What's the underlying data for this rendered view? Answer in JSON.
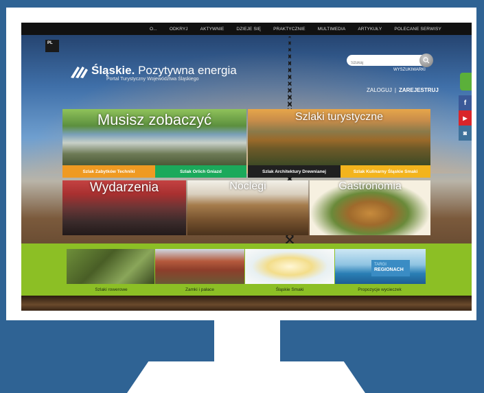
{
  "nav": {
    "items": [
      "O...",
      "ODKRYJ",
      "AKTYWNIE",
      "DZIEJE SIĘ",
      "PRAKTYCZNIE",
      "MULTIMEDIA",
      "ARTYKUŁY",
      "POLECANE SERWISY"
    ]
  },
  "lang": "PL",
  "logo": {
    "brand": "Śląskie.",
    "tagline": "Pozytywna energia",
    "sub": "Portal Turystyczny Województwa Śląskiego"
  },
  "search": {
    "placeholder": "Szukaj",
    "link": "WYSZUKIWARKI"
  },
  "auth": {
    "login": "ZALOGUJ",
    "separator": "|",
    "register": "ZAREJESTRUJ"
  },
  "social": {
    "facebook": "f",
    "youtube": "▶",
    "instagram": "◙"
  },
  "tiles": {
    "musisz": "Musisz zobaczyć",
    "szlaki": "Szlaki turystyczne",
    "wydarzenia": "Wydarzenia",
    "noclegi": "Noclegi",
    "gastronomia": "Gastronomia"
  },
  "chips": [
    "Szlak Zabytków Techniki",
    "Szlak Orlich Gniazd",
    "Szlak Architektury Drewnianej",
    "Szlak Kulinarny Śląskie Smaki"
  ],
  "thumbs": {
    "regionach_top": "TARGI",
    "regionach": "REGIONACH",
    "captions": [
      "Szlaki rowerowe",
      "Zamki i pałace",
      "Śląskie Smaki",
      "Propozycje wycieczek"
    ]
  },
  "colors": {
    "background": "#2f6394",
    "band": "#8cbf25",
    "chip_orange": "#ef9a22",
    "chip_green": "#1ba95b",
    "chip_black": "#202020",
    "chip_yellow": "#f3b41d"
  }
}
